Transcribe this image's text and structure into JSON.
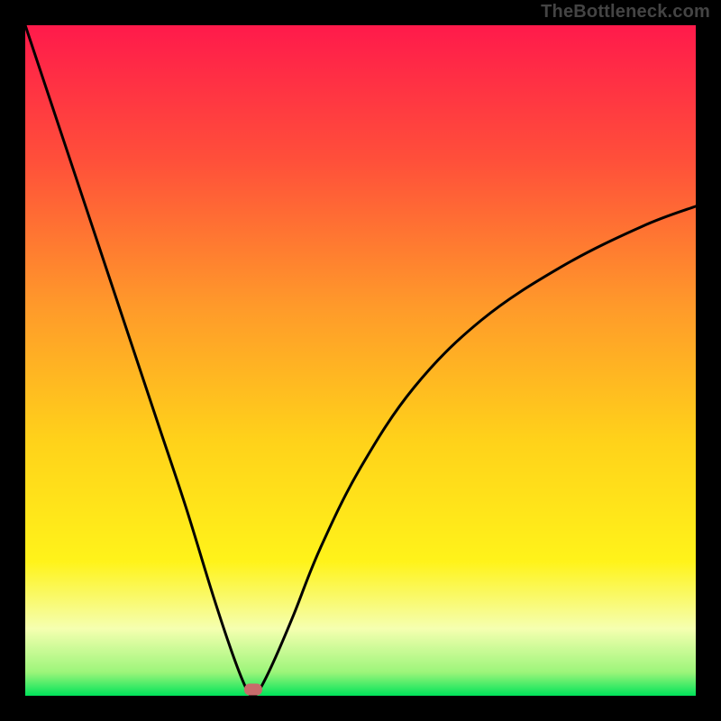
{
  "watermark": "TheBottleneck.com",
  "chart_data": {
    "type": "line",
    "title": "",
    "xlabel": "",
    "ylabel": "",
    "xlim": [
      0,
      100
    ],
    "ylim": [
      0,
      100
    ],
    "grid": false,
    "background_gradient": {
      "stops": [
        {
          "offset": 0.0,
          "color": "#ff1a4b"
        },
        {
          "offset": 0.2,
          "color": "#ff4f3a"
        },
        {
          "offset": 0.42,
          "color": "#ff9a2a"
        },
        {
          "offset": 0.62,
          "color": "#ffd21a"
        },
        {
          "offset": 0.8,
          "color": "#fff31a"
        },
        {
          "offset": 0.9,
          "color": "#f5ffb0"
        },
        {
          "offset": 0.965,
          "color": "#9cf57a"
        },
        {
          "offset": 1.0,
          "color": "#00e35a"
        }
      ]
    },
    "optimum_marker": {
      "x": 34,
      "y": 1,
      "color": "#c76b6b"
    },
    "curve": {
      "description": "Bottleneck percentage vs component index; minimum (0%) near x≈34",
      "x": [
        0,
        4,
        8,
        12,
        16,
        20,
        24,
        28,
        31,
        33,
        34,
        35,
        37,
        40,
        44,
        50,
        58,
        68,
        80,
        92,
        100
      ],
      "y": [
        100,
        88,
        76,
        64,
        52,
        40,
        28,
        15,
        6,
        1,
        0,
        1,
        5,
        12,
        22,
        34,
        46,
        56,
        64,
        70,
        73
      ]
    }
  }
}
